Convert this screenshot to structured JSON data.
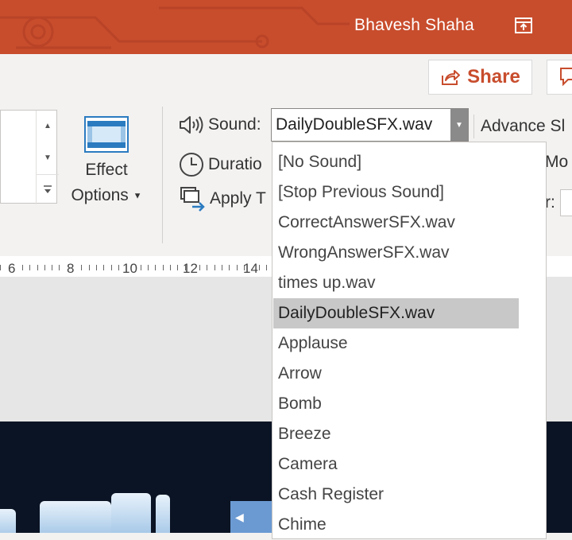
{
  "titlebar": {
    "user_name": "Bhavesh Shaha",
    "bg_color": "#c84d2d"
  },
  "share": {
    "label": "Share",
    "accent_color": "#c84d2d"
  },
  "ribbon": {
    "effect_options_line1": "Effect",
    "effect_options_line2": "Options",
    "sound_label": "Sound:",
    "sound_value": "DailyDoubleSFX.wav",
    "duration_label": "Duratio",
    "apply_label": "Apply T",
    "advance_label": "Advance Sl",
    "on_mouse_label": "Mo",
    "after_label": "r:"
  },
  "ruler": {
    "labels": [
      "6",
      "8",
      "10",
      "12",
      "14"
    ]
  },
  "sound_dropdown": {
    "selected_index": 5,
    "items": [
      "[No Sound]",
      "[Stop Previous Sound]",
      "CorrectAnswerSFX.wav",
      "WrongAnswerSFX.wav",
      "times up.wav",
      "DailyDoubleSFX.wav",
      "Applause",
      "Arrow",
      "Bomb",
      "Breeze",
      "Camera",
      "Cash Register",
      "Chime"
    ]
  }
}
